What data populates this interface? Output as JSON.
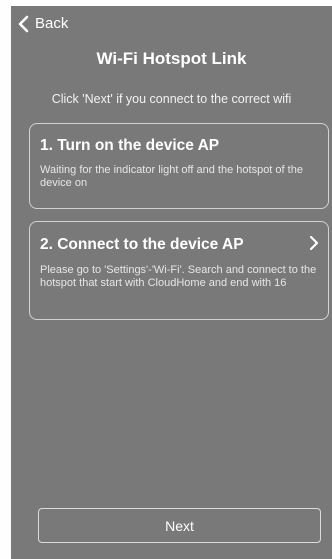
{
  "header": {
    "back_label": "Back",
    "title": "Wi-Fi Hotspot Link"
  },
  "instruction": "Click 'Next' if you connect to the correct wifi",
  "steps": [
    {
      "title": "1. Turn on the device AP",
      "description": "Waiting for the indicator light off and the hotspot of the device on"
    },
    {
      "title": "2. Connect to the device AP",
      "description": "Please go to 'Settings'-'Wi-Fi'. Search and connect to the hotspot that start with CloudHome and end with 16"
    }
  ],
  "footer": {
    "next_label": "Next"
  },
  "colors": {
    "screen_background": "#797979",
    "text": "#ffffff",
    "border": "#d2d2d2"
  },
  "icons": {
    "back": "chevron-left-icon",
    "step_action": "chevron-right-icon"
  }
}
